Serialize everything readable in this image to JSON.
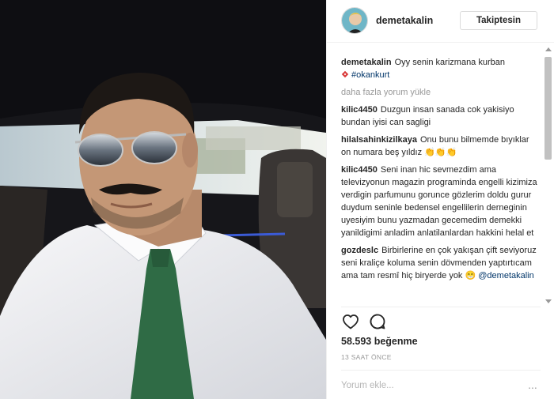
{
  "post": {
    "username": "demetakalin",
    "follow_label": "Takiptesin",
    "caption": {
      "username": "demetakalin",
      "text": "Oyy senin karizmana kurban",
      "emoji_icon": "red-diamond-icon",
      "hashtag": "#okankurt"
    },
    "load_more_label": "daha fazla yorum yükle",
    "comments": [
      {
        "username": "kilic4450",
        "text": "Duzgun insan sanada cok yakisiyo bundan iyisi can sagligi"
      },
      {
        "username": "hilalsahinkizilkaya",
        "text": "Onu bunu bilmemde bıyıklar on numara beş yıldız 👏👏👏"
      },
      {
        "username": "kilic4450",
        "text": "Seni inan hic sevmezdim ama televizyonun magazin programinda engelli kizimiza verdigin parfumunu gorunce gözlerim doldu gurur duydum seninle bedensel engellilerin derneginin uyesiyim bunu yazmadan gecemedim demekki yanildigimi anladim anlatilanlardan hakkini helal et"
      },
      {
        "username": "gozdeslc",
        "text": "Birbirlerine en çok yakışan çift seviyoruz seni kraliçe koluma senin dövmenden yaptırtıcam ama tam resmî hiç biryerde yok 😁",
        "mention": "@demetakalin"
      }
    ],
    "likes_label": "58.593 beğenme",
    "timestamp": "13 SAAT ÖNCE",
    "comment_placeholder": "Yorum ekle...",
    "more_label": "..."
  },
  "colors": {
    "link": "#003569",
    "muted": "#999999",
    "border": "#efefef",
    "tie": "#2f6b45"
  },
  "icons": [
    "heart-icon",
    "comment-bubble-icon",
    "more-options-icon"
  ]
}
